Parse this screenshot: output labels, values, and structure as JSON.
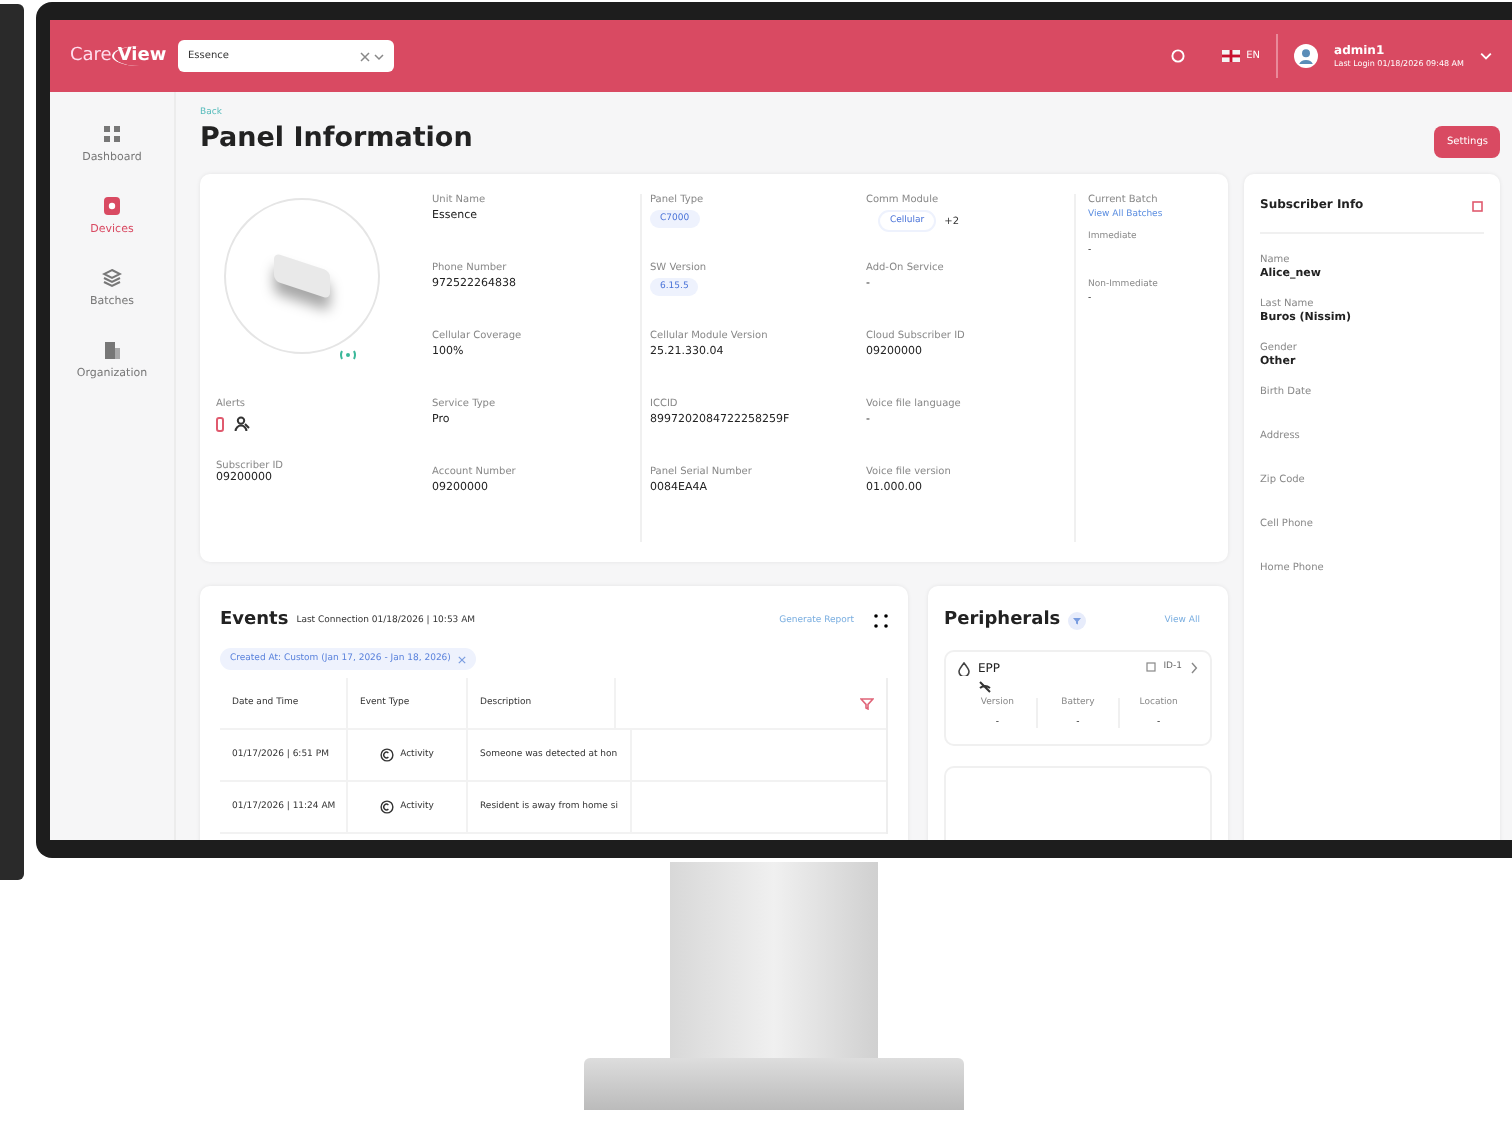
{
  "header": {
    "logo_left": "Care",
    "logo_right": "View",
    "search_value": "Essence",
    "language": "EN",
    "user": "admin1",
    "last_login": "Last Login 01/18/2026 09:48 AM"
  },
  "sidebar": {
    "items": [
      {
        "label": "Dashboard",
        "selected": false
      },
      {
        "label": "Devices",
        "selected": true
      },
      {
        "label": "Batches",
        "selected": false
      },
      {
        "label": "Organization",
        "selected": false
      }
    ]
  },
  "breadcrumb": "Back",
  "title": "Panel Information",
  "settings_button": "Settings",
  "panel": {
    "alerts_label": "Alerts",
    "subscriber_id": {
      "label": "Subscriber ID",
      "value": "09200000"
    },
    "columns": [
      [
        {
          "kind": "text",
          "label": "Unit Name",
          "value": "Essence"
        },
        {
          "kind": "text",
          "label": "Phone Number",
          "value": "972522264838"
        },
        {
          "kind": "text",
          "label": "Cellular Coverage",
          "value": "100%"
        },
        {
          "kind": "text",
          "label": "Service Type",
          "value": "Pro"
        },
        {
          "kind": "text",
          "label": "Account Number",
          "value": "09200000"
        }
      ],
      [
        {
          "kind": "chip",
          "label": "Panel Type",
          "value": "C7000"
        },
        {
          "kind": "chip",
          "label": "SW Version",
          "value": "6.15.5"
        },
        {
          "kind": "text",
          "label": "Cellular Module Version",
          "value": "25.21.330.04"
        },
        {
          "kind": "text",
          "label": "ICCID",
          "value": "8997202084722258259F"
        },
        {
          "kind": "text",
          "label": "Panel Serial Number",
          "value": "0084EA4A"
        }
      ],
      [
        {
          "kind": "chip_more",
          "label": "Comm Module",
          "value": "Cellular",
          "more": "+2"
        },
        {
          "kind": "text",
          "label": "Add-On Service",
          "value": "-"
        },
        {
          "kind": "text",
          "label": "Cloud Subscriber ID",
          "value": "09200000"
        },
        {
          "kind": "text",
          "label": "Voice file language",
          "value": "-"
        },
        {
          "kind": "text",
          "label": "Voice file version",
          "value": "01.000.00"
        }
      ]
    ],
    "batch": {
      "title": "Current Batch",
      "link": "View All Batches",
      "items": [
        {
          "label": "Immediate",
          "value": "-"
        },
        {
          "label": "Non-Immediate",
          "value": "-"
        }
      ]
    }
  },
  "subscriber": {
    "title": "Subscriber Info",
    "fields": [
      {
        "label": "Name",
        "value": "Alice_new"
      },
      {
        "label": "Last Name",
        "value": "Buros (Nissim)"
      },
      {
        "label": "Gender",
        "value": "Other"
      },
      {
        "label": "Birth Date"
      },
      {
        "label": "Address"
      },
      {
        "label": "Zip Code"
      },
      {
        "label": "Cell Phone"
      },
      {
        "label": "Home Phone"
      }
    ]
  },
  "events": {
    "title": "Events",
    "last_connection": "Last Connection 01/18/2026 | 10:53 AM",
    "generate_report": "Generate Report",
    "filter": "Created At: Custom (Jan 17, 2026 - Jan 18, 2026)",
    "columns": [
      "Date and Time",
      "Event Type",
      "Description"
    ],
    "rows": [
      {
        "date": "01/17/2026 | 6:51 PM",
        "type": "Activity",
        "description": "Someone was detected at hon"
      },
      {
        "date": "01/17/2026 | 11:24 AM",
        "type": "Activity",
        "description": "Resident is away from home si"
      }
    ]
  },
  "peripherals": {
    "title": "Peripherals",
    "view_all": "View All",
    "cards": [
      {
        "name": "EPP",
        "id": "ID-1",
        "stats": [
          {
            "label": "Version",
            "value": "-"
          },
          {
            "label": "Battery",
            "value": "-"
          },
          {
            "label": "Location",
            "value": "-"
          }
        ]
      }
    ]
  }
}
